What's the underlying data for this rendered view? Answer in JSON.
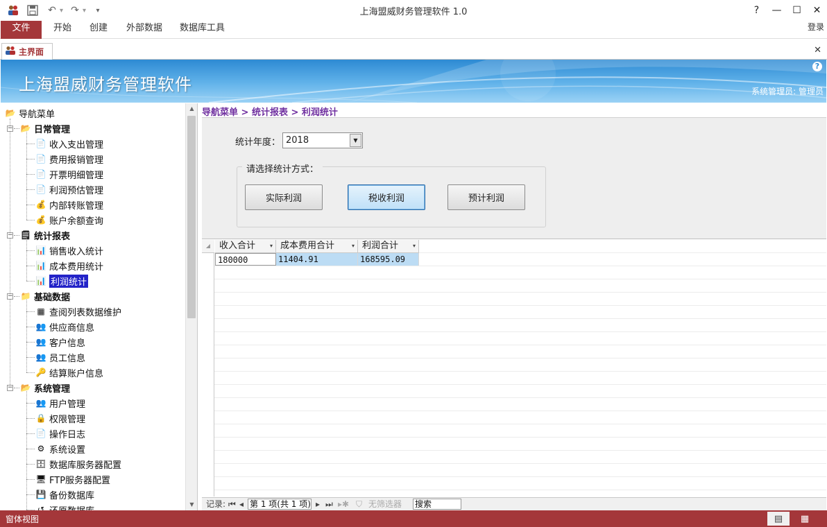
{
  "window": {
    "title": "上海盟威财务管理软件 1.0",
    "help": "?",
    "minimize": "—",
    "maximize": "☐",
    "close": "✕"
  },
  "ribbon": {
    "tabs": [
      "文件",
      "开始",
      "创建",
      "外部数据",
      "数据库工具"
    ],
    "login": "登录"
  },
  "doc_tab": {
    "label": "主界面",
    "close": "✕"
  },
  "banner": {
    "title": "上海盟威财务管理软件",
    "user": "系统管理员: 管理员",
    "help": "?"
  },
  "nav": {
    "root": "导航菜单",
    "groups": [
      {
        "label": "日常管理",
        "items": [
          "收入支出管理",
          "费用报销管理",
          "开票明细管理",
          "利润预估管理",
          "内部转账管理",
          "账户余额查询"
        ]
      },
      {
        "label": "统计报表",
        "items": [
          "销售收入统计",
          "成本费用统计",
          "利润统计"
        ]
      },
      {
        "label": "基础数据",
        "items": [
          "查阅列表数据维护",
          "供应商信息",
          "客户信息",
          "员工信息",
          "结算账户信息"
        ]
      },
      {
        "label": "系统管理",
        "items": [
          "用户管理",
          "权限管理",
          "操作日志",
          "系统设置",
          "数据库服务器配置",
          "FTP服务器配置",
          "备份数据库",
          "还原数据库"
        ]
      }
    ],
    "selected": "利润统计"
  },
  "main": {
    "breadcrumb": "导航菜单 > 统计报表 > 利润统计",
    "year_label": "统计年度：",
    "year_value": "2018",
    "group_title": "请选择统计方式：",
    "buttons": [
      "实际利润",
      "税收利润",
      "预计利润"
    ],
    "active_button": "税收利润"
  },
  "grid": {
    "columns": [
      "收入合计",
      "成本费用合计",
      "利润合计"
    ],
    "rows": [
      [
        "180000",
        "11404.91",
        "168595.09"
      ]
    ]
  },
  "navigator": {
    "record_label": "记录:",
    "position": "第 1 项(共 1 项)",
    "filter": "无筛选器",
    "search": "搜索"
  },
  "statusbar": {
    "text": "窗体视图"
  },
  "colors": {
    "accent": "#a4373a",
    "selection": "#2323c8",
    "breadcrumb": "#7030a0",
    "banner": "#2d8ad3"
  }
}
